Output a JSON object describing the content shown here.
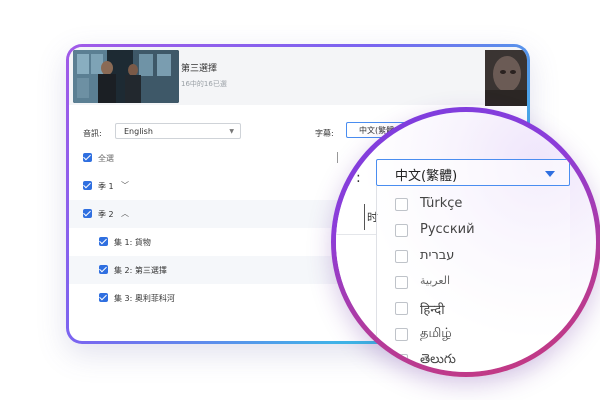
{
  "header": {
    "title": "第三選擇",
    "subtitle": "16中的16已選"
  },
  "audio": {
    "label": "音訊:",
    "value": "English"
  },
  "subtitle_select": {
    "label": "字幕:",
    "value": "中文(繁體)"
  },
  "list": {
    "select_all": "全選",
    "season1": "季 1",
    "season2": "季 2",
    "episodes": [
      "集 1: 貨物",
      "集 2: 第三選擇",
      "集 3: 奧利菲科河"
    ]
  },
  "magnifier": {
    "colon": ":",
    "selected": "中文(繁體)",
    "side_text": "时",
    "options": [
      "Türkçe",
      "Русский",
      "עברית",
      "العربية",
      "हिन्दी",
      "தமிழ்",
      "తెలుగు"
    ]
  },
  "colors": {
    "accent": "#2f6fe0",
    "ring_start": "#7a3de0",
    "ring_end": "#c8397c",
    "card_border_start": "#a15ae8",
    "card_border_end": "#2fd0e2"
  }
}
